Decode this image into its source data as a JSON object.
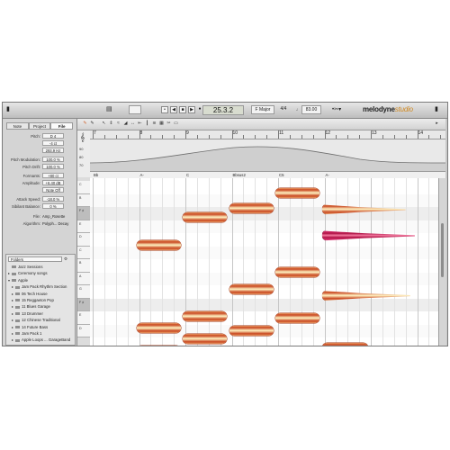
{
  "toolbar": {
    "meter_box": "",
    "position": "25.3.2",
    "key": "F Major",
    "time_signature": "4/4",
    "tempo": "83.00",
    "tempo_prefix": "♩",
    "controls": [
      "•",
      "◀",
      "■",
      "▶",
      "●"
    ],
    "app_name": "melodyne",
    "edition": "studio"
  },
  "inspector": {
    "tabs": [
      "Note",
      "Project",
      "File"
    ],
    "active_tab": "File",
    "params": [
      {
        "label": "Pitch:",
        "value": "D 4"
      },
      {
        "label": "",
        "value": "-4 ct"
      },
      {
        "label": "",
        "value": "293.9 Hz"
      },
      {
        "label": "Pitch Modulation:",
        "value": "100.0 %"
      },
      {
        "label": "Pitch Drift:",
        "value": "100.0 %"
      },
      {
        "label": "Formants:",
        "value": "+80 ct"
      },
      {
        "label": "Amplitude:",
        "value": "+6.40 dB"
      },
      {
        "label": "",
        "value": "Note Off"
      },
      {
        "label": "Attack Speed:",
        "value": "-18.0 %"
      },
      {
        "label": "Sibilant Balance:",
        "value": "0 %"
      }
    ],
    "file_label": "File:",
    "file_value": "Amp_Rosette",
    "algo_label": "Algorithm:",
    "algo_value": "Polyph... Decay"
  },
  "browser": {
    "selector": "Folders",
    "items": [
      {
        "label": "Jazz Sessions",
        "indent": 0,
        "arrow": ""
      },
      {
        "label": "Ceremony songs",
        "indent": 0,
        "arrow": "▸"
      },
      {
        "label": "Apple",
        "indent": 0,
        "arrow": "▾"
      },
      {
        "label": "Jam Pack Rhythm Section",
        "indent": 1,
        "arrow": "▸"
      },
      {
        "label": "06 Tech House",
        "indent": 1,
        "arrow": "▸"
      },
      {
        "label": "15 Reggaeton Pop",
        "indent": 1,
        "arrow": "▸"
      },
      {
        "label": "11 Blues Garage",
        "indent": 1,
        "arrow": "▸"
      },
      {
        "label": "13 Drummer",
        "indent": 1,
        "arrow": "▸"
      },
      {
        "label": "12 Chinese Traditional",
        "indent": 1,
        "arrow": "▸"
      },
      {
        "label": "14 Future Bass",
        "indent": 1,
        "arrow": "▸"
      },
      {
        "label": "Jam Pack 1",
        "indent": 1,
        "arrow": "▸"
      },
      {
        "label": "Apple Loops ... GarageBand",
        "indent": 1,
        "arrow": "▸"
      }
    ]
  },
  "ruler": {
    "bars": [
      "7",
      "8",
      "9",
      "10",
      "11",
      "12",
      "13",
      "14"
    ]
  },
  "tempo_scale": [
    "90",
    "80",
    "70"
  ],
  "chords": [
    "Bb",
    "A-",
    "C",
    "Bbsus2",
    "C5",
    "A-"
  ],
  "piano_keys": [
    "C",
    "B",
    "F ♯",
    "E",
    "D",
    "C",
    "B",
    "A",
    "G",
    "F ♯",
    "E",
    "D"
  ],
  "notes": [
    {
      "bar": 7.95,
      "len": 0.95,
      "pitch_row": 4.4,
      "selected": false
    },
    {
      "bar": 8.95,
      "len": 0.95,
      "pitch_row": 2.3,
      "selected": false
    },
    {
      "bar": 9.95,
      "len": 0.95,
      "pitch_row": 1.6,
      "selected": false
    },
    {
      "bar": 10.95,
      "len": 0.95,
      "pitch_row": 0.4,
      "selected": false
    },
    {
      "bar": 11.95,
      "len": 1.8,
      "pitch_row": 1.7,
      "selected": false
    },
    {
      "bar": 11.95,
      "len": 2.0,
      "pitch_row": 3.7,
      "selected": true
    },
    {
      "bar": 10.95,
      "len": 0.95,
      "pitch_row": 6.5,
      "selected": false
    },
    {
      "bar": 9.95,
      "len": 0.95,
      "pitch_row": 7.8,
      "selected": false
    },
    {
      "bar": 11.95,
      "len": 1.9,
      "pitch_row": 8.3,
      "selected": false
    },
    {
      "bar": 8.95,
      "len": 0.95,
      "pitch_row": 9.9,
      "selected": false
    },
    {
      "bar": 10.95,
      "len": 0.95,
      "pitch_row": 10.0,
      "selected": false
    },
    {
      "bar": 7.95,
      "len": 0.95,
      "pitch_row": 10.8,
      "selected": false
    },
    {
      "bar": 9.95,
      "len": 0.95,
      "pitch_row": 11.0,
      "selected": false
    },
    {
      "bar": 8.95,
      "len": 0.95,
      "pitch_row": 11.6,
      "selected": false
    },
    {
      "bar": 7.95,
      "len": 0.95,
      "pitch_row": 12.5,
      "selected": false
    },
    {
      "bar": 11.95,
      "len": 1.0,
      "pitch_row": 12.3,
      "selected": false
    }
  ],
  "colors": {
    "note": "#e07a3a",
    "note_selected": "#c2185b",
    "brand_accent": "#d08a24"
  }
}
